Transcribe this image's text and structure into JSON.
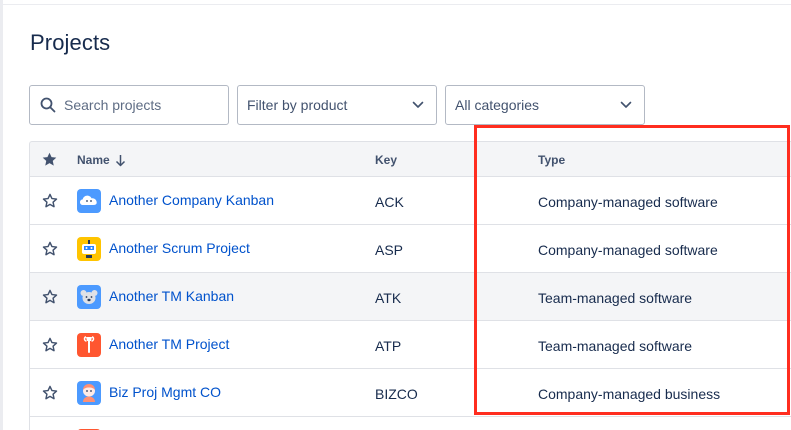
{
  "page": {
    "title": "Projects"
  },
  "filters": {
    "search_placeholder": "Search projects",
    "product_select": "Filter by product",
    "category_select": "All categories"
  },
  "table": {
    "headers": {
      "name": "Name",
      "key": "Key",
      "type": "Type"
    },
    "rows": [
      {
        "name": "Another Company Kanban",
        "key": "ACK",
        "type": "Company-managed software",
        "avatar_icon": "cloud-avatar-icon",
        "avatar_color": "#4c9aff"
      },
      {
        "name": "Another Scrum Project",
        "key": "ASP",
        "type": "Company-managed software",
        "avatar_icon": "robot-avatar-icon",
        "avatar_color": "#ffc400"
      },
      {
        "name": "Another TM Kanban",
        "key": "ATK",
        "type": "Team-managed software",
        "avatar_icon": "koala-avatar-icon",
        "avatar_color": "#4c9aff"
      },
      {
        "name": "Another TM Project",
        "key": "ATP",
        "type": "Team-managed software",
        "avatar_icon": "wrench-avatar-icon",
        "avatar_color": "#ff5630"
      },
      {
        "name": "Biz Proj Mgmt CO",
        "key": "BIZCO",
        "type": "Company-managed business",
        "avatar_icon": "person-avatar-icon",
        "avatar_color": "#4c9aff"
      }
    ]
  },
  "colors": {
    "link": "#0052cc",
    "highlight_border": "#ff2d1f",
    "header_bg": "#f4f5f7",
    "hover_row_bg": "#f4f5f7"
  }
}
